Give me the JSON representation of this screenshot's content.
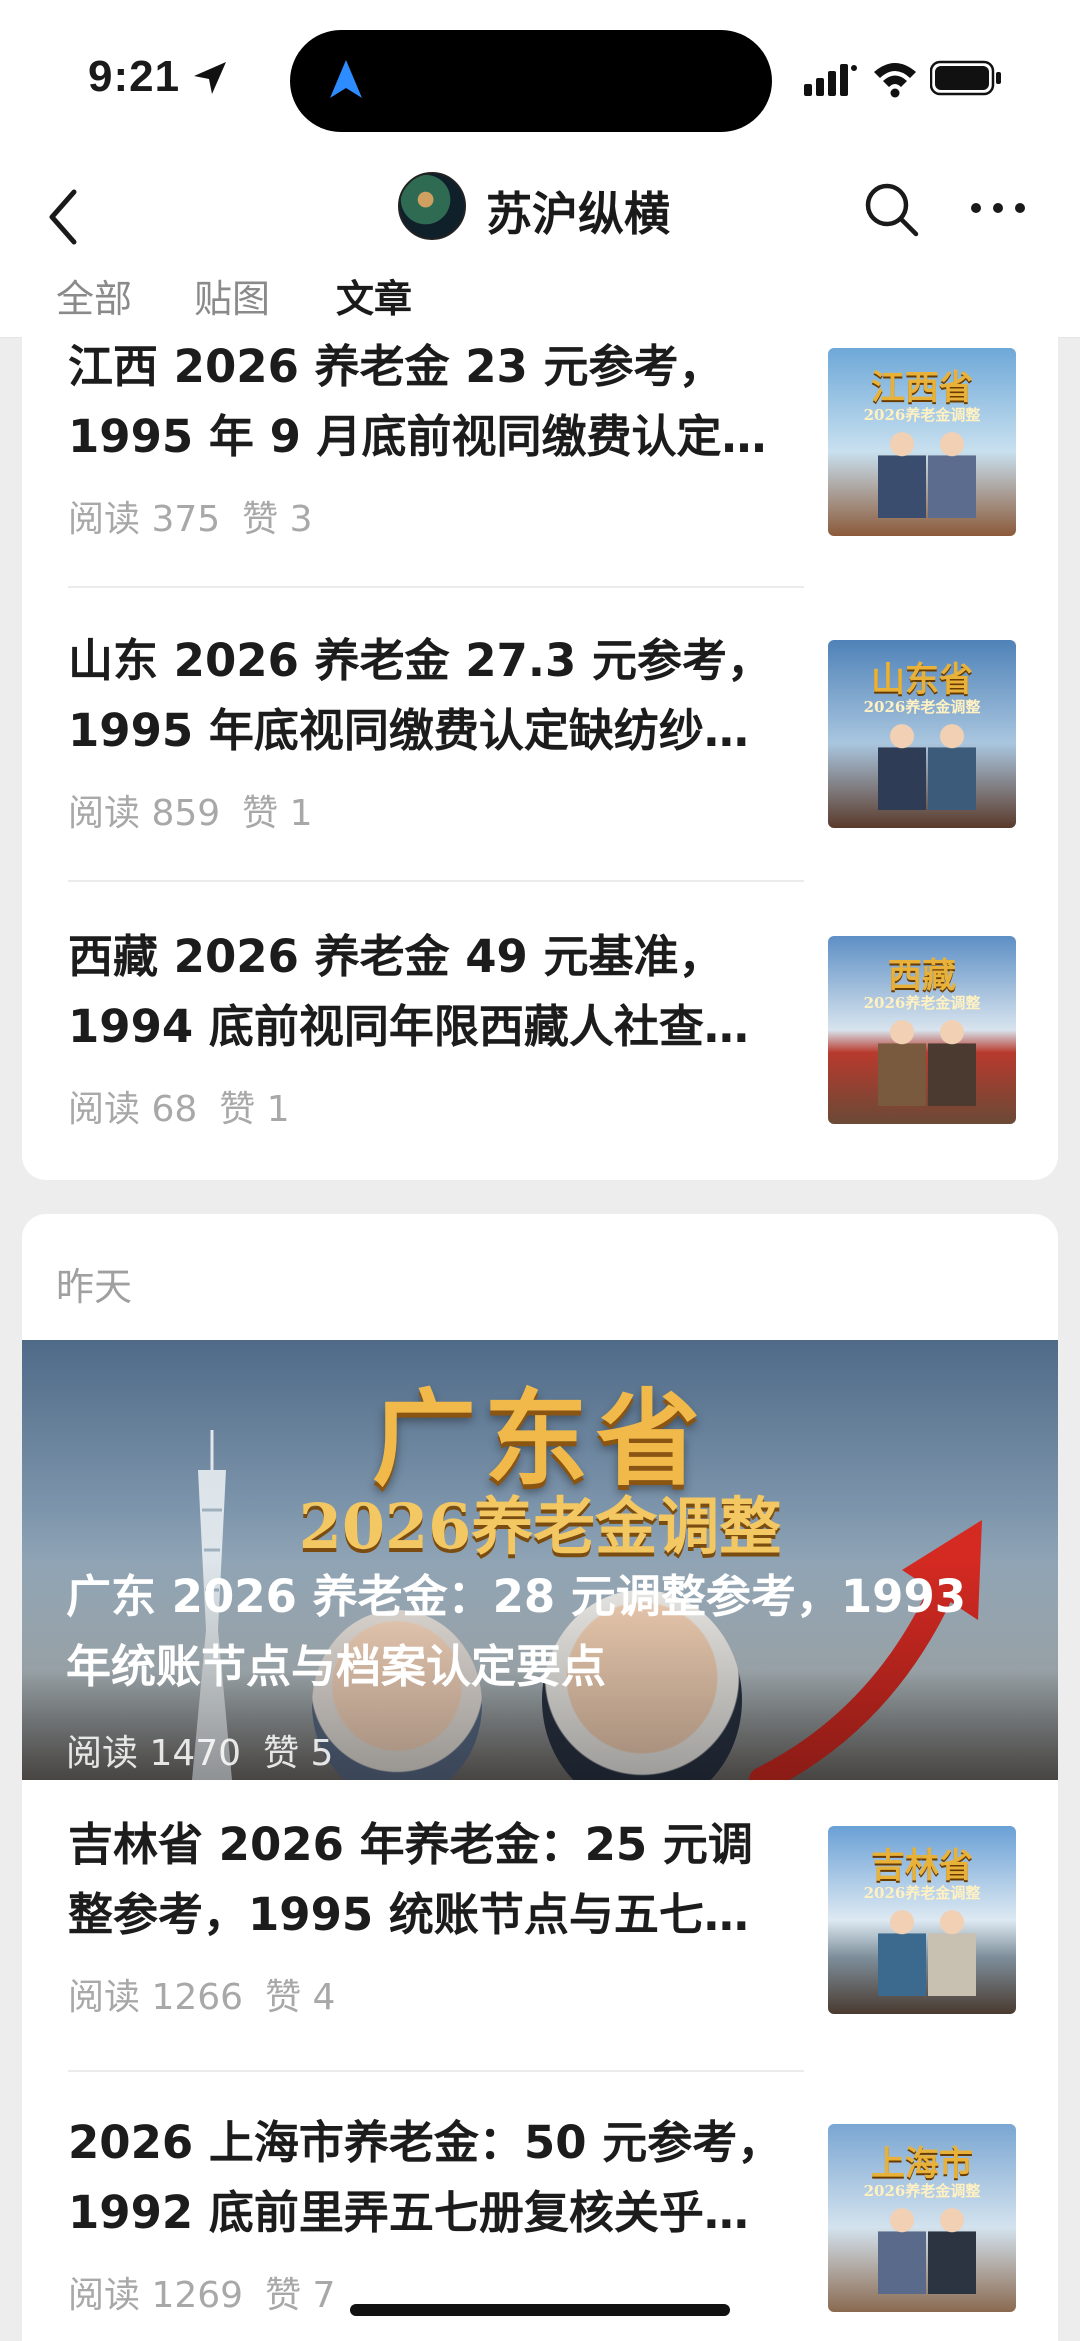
{
  "status": {
    "time": "9:21"
  },
  "header": {
    "title": "苏沪纵横",
    "tabs": [
      "全部",
      "贴图",
      "文章"
    ],
    "active_tab": "文章"
  },
  "group1": {
    "articles": [
      {
        "line1": "江西 2026 养老金 23 元参考，",
        "line2": "1995 年 9 月底前视同缴费认定…",
        "reads": "阅读 375",
        "likes": "赞 3",
        "thumb_label": "江西省",
        "thumb_sub": "2026养老金调整"
      },
      {
        "line1": "山东 2026 养老金 27.3 元参考，",
        "line2": "1995 年底视同缴费认定缺纺纱…",
        "reads": "阅读 859",
        "likes": "赞 1",
        "thumb_label": "山东省",
        "thumb_sub": "2026养老金调整"
      },
      {
        "line1": "西藏 2026 养老金 49 元基准，",
        "line2": "1994 底前视同年限西藏人社查…",
        "reads": "阅读 68",
        "likes": "赞 1",
        "thumb_label": "西藏",
        "thumb_sub": "2026养老金调整"
      }
    ]
  },
  "group2": {
    "section_label": "昨天",
    "banner": {
      "big_text": "广东省",
      "sub_text": "2026养老金调整",
      "line1": "广东 2026 养老金：28 元调整参考，1993",
      "line2": "年统账节点与档案认定要点",
      "reads": "阅读 1470",
      "likes": "赞 5"
    },
    "articles": [
      {
        "line1": "吉林省 2026 年养老金：25 元调",
        "line2": "整参考，1995 统账节点与五七…",
        "reads": "阅读 1266",
        "likes": "赞 4",
        "thumb_label": "吉林省",
        "thumb_sub": "2026养老金调整"
      },
      {
        "line1": "2026 上海市养老金：50 元参考，",
        "line2": "1992 底前里弄五七册复核关乎…",
        "reads": "阅读 1269",
        "likes": "赞 7",
        "thumb_label": "上海市",
        "thumb_sub": "2026养老金调整"
      }
    ]
  },
  "colors": {
    "accent": "#1a1a1a",
    "muted": "#a8a8a8",
    "background": "#ededed",
    "gold": "#e8b23a"
  }
}
